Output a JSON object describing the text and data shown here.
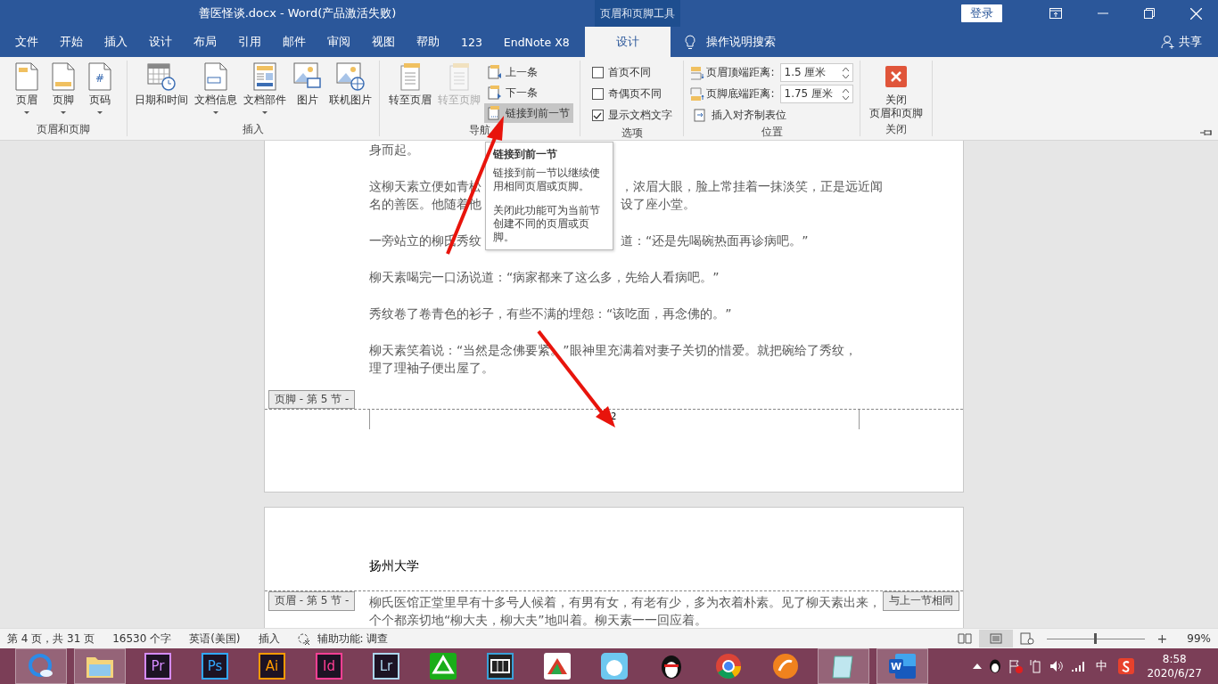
{
  "window": {
    "title": "善医怪谈.docx  -  Word(产品激活失败)",
    "context_tab": "页眉和页脚工具",
    "sign_in": "登录"
  },
  "tabs": [
    {
      "label": "文件",
      "selected": false
    },
    {
      "label": "开始",
      "selected": false
    },
    {
      "label": "插入",
      "selected": false
    },
    {
      "label": "设计",
      "selected": false
    },
    {
      "label": "布局",
      "selected": false
    },
    {
      "label": "引用",
      "selected": false
    },
    {
      "label": "邮件",
      "selected": false
    },
    {
      "label": "审阅",
      "selected": false
    },
    {
      "label": "视图",
      "selected": false
    },
    {
      "label": "帮助",
      "selected": false
    },
    {
      "label": "123",
      "selected": false
    },
    {
      "label": "EndNote X8",
      "selected": false
    },
    {
      "label": "设计",
      "selected": true
    }
  ],
  "search": {
    "placeholder": "操作说明搜索"
  },
  "share": "共享",
  "ribbon": {
    "groups": [
      {
        "label": "页眉和页脚",
        "items": [
          {
            "kind": "large",
            "label_lines": [
              "页眉"
            ],
            "dropdown": true,
            "disabled": false
          },
          {
            "kind": "large",
            "label_lines": [
              "页脚"
            ],
            "dropdown": true,
            "disabled": false
          },
          {
            "kind": "large",
            "icon_text": "#",
            "label_lines": [
              "页码"
            ],
            "dropdown": true,
            "disabled": false
          }
        ]
      },
      {
        "label": "插入",
        "items": [
          {
            "kind": "large",
            "label_lines": [
              "日期和时间"
            ],
            "dropdown": false,
            "disabled": false
          },
          {
            "kind": "large",
            "label_lines": [
              "文档信息"
            ],
            "dropdown": true,
            "disabled": false
          },
          {
            "kind": "large",
            "label_lines": [
              "文档部件"
            ],
            "dropdown": true,
            "disabled": false
          },
          {
            "kind": "large",
            "label_lines": [
              "图片"
            ],
            "dropdown": false,
            "disabled": false
          },
          {
            "kind": "large",
            "label_lines": [
              "联机图片"
            ],
            "dropdown": false,
            "disabled": false
          }
        ]
      },
      {
        "label": "导航",
        "items": [
          {
            "kind": "large",
            "label_lines": [
              "转至页眉"
            ],
            "dropdown": false,
            "disabled": false
          },
          {
            "kind": "large",
            "label_lines": [
              "转至页脚"
            ],
            "dropdown": false,
            "disabled": true
          },
          {
            "kind": "stack",
            "items": [
              {
                "kind": "small",
                "label": "上一条",
                "hovered": false
              },
              {
                "kind": "small",
                "label": "下一条",
                "hovered": false
              },
              {
                "kind": "small",
                "label": "链接到前一节",
                "hovered": true
              }
            ]
          }
        ]
      },
      {
        "label": "选项",
        "items": [
          {
            "kind": "stack",
            "items": [
              {
                "kind": "check",
                "label": "首页不同",
                "checked": false
              },
              {
                "kind": "check",
                "label": "奇偶页不同",
                "checked": false
              },
              {
                "kind": "check",
                "label": "显示文档文字",
                "checked": true
              }
            ]
          }
        ]
      },
      {
        "label": "位置",
        "items": [
          {
            "kind": "stack",
            "items": [
              {
                "kind": "spin",
                "label": "页眉顶端距离:",
                "value": "1.5 厘米"
              },
              {
                "kind": "spin",
                "label": "页脚底端距离:",
                "value": "1.75 厘米"
              },
              {
                "kind": "small",
                "label": "插入对齐制表位",
                "hovered": false
              }
            ]
          }
        ]
      },
      {
        "label": "关闭",
        "items": [
          {
            "kind": "large",
            "label_lines": [
              "关闭",
              "页眉和页脚"
            ],
            "dropdown": false,
            "disabled": false
          }
        ]
      }
    ]
  },
  "tooltip": {
    "title": "链接到前一节",
    "paragraphs": [
      "链接到前一节以继续使用相同页眉或页脚。",
      "关闭此功能可为当前节创建不同的页眉或页脚。"
    ]
  },
  "page1": {
    "paragraphs": [
      [
        [
          "身而起。"
        ]
      ],
      [
        [
          "这柳天素立便如青松",
          "，浓眉大眼，脸上常挂着一抹淡笑，正是远近闻"
        ],
        [
          "名的善医。他随着他",
          "设了座小堂。"
        ]
      ],
      [
        [
          "一旁站立的柳氏秀纹",
          "道：“还是先喝碗热面再诊病吧。”"
        ]
      ],
      [
        [
          "柳天素喝完一口汤说道：“病家都来了这么多，先给人看病吧。”"
        ]
      ],
      [
        [
          "秀纹卷了卷青色的衫子，有些不满的埋怨：“该吃面，再念佛的。”"
        ]
      ],
      [
        [
          "柳天素笑着说：“当然是念佛要紧。”眼神里充满着对妻子关切的惜爱。就把碗给了秀纹，"
        ],
        [
          "理了理袖子便出屋了。"
        ]
      ]
    ],
    "footer_label": "页脚 - 第 5 节 -",
    "page_number": "2"
  },
  "page2": {
    "header_text": "扬州大学",
    "header_label": "页眉 - 第 5 节 -",
    "same_as_previous": "与上一节相同",
    "paragraphs": [
      [
        [
          "柳氏医馆正堂里早有十多号人候着，有男有女，有老有少，多为衣着朴素。见了柳天素出来，"
        ],
        [
          "个个都亲切地“柳大夫，柳大夫”地叫着。柳天素一一回应着。"
        ]
      ]
    ]
  },
  "status_bar": {
    "items": [
      "第 4 页，共 31 页",
      "16530 个字",
      "英语(美国)",
      "插入",
      "辅助功能: 调查"
    ],
    "zoom_in": "+",
    "zoom": "99%",
    "zoom_level": {
      "level": 0.5
    }
  },
  "taskbar": {
    "apps": [
      {
        "kind": "browser",
        "running": true
      },
      {
        "kind": "folder",
        "running": true
      },
      {
        "kind": "tile",
        "label": "Pr",
        "color": "#d58bff",
        "running": false
      },
      {
        "kind": "tile",
        "label": "Ps",
        "color": "#31a8ff",
        "running": false
      },
      {
        "kind": "tile",
        "label": "Ai",
        "color": "#ff9a00",
        "running": false
      },
      {
        "kind": "tile",
        "label": "Id",
        "color": "#ff3f94",
        "running": false
      },
      {
        "kind": "tile",
        "label": "Lr",
        "color": "#add5ec",
        "running": false
      },
      {
        "kind": "green",
        "running": false
      },
      {
        "kind": "film",
        "running": false
      },
      {
        "kind": "red",
        "running": false
      },
      {
        "kind": "cat",
        "running": false
      },
      {
        "kind": "penguin",
        "running": false
      },
      {
        "kind": "chrome",
        "running": false
      },
      {
        "kind": "orange",
        "running": false
      },
      {
        "kind": "notepad",
        "running": true
      },
      {
        "kind": "word",
        "label": "W",
        "running": true
      }
    ],
    "ime": "中",
    "time": "8:58",
    "date": "2020/6/27"
  }
}
